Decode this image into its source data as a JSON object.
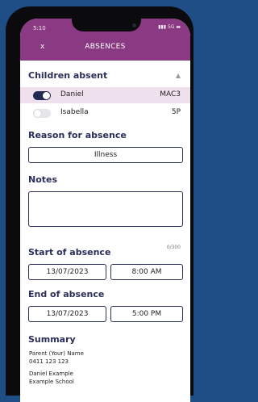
{
  "status": {
    "time": "5:10",
    "network": "5G"
  },
  "header": {
    "close_label": "x",
    "title": "ABSENCES"
  },
  "children_absent": {
    "heading": "Children absent",
    "children": [
      {
        "name": "Daniel",
        "class": "MAC3",
        "selected": true
      },
      {
        "name": "Isabella",
        "class": "5P",
        "selected": false
      }
    ]
  },
  "reason": {
    "heading": "Reason for absence",
    "value": "Illness"
  },
  "notes": {
    "heading": "Notes",
    "value": "",
    "counter": "0/300"
  },
  "start": {
    "heading": "Start of absence",
    "date": "13/07/2023",
    "time": "8:00 AM"
  },
  "end": {
    "heading": "End of absence",
    "date": "13/07/2023",
    "time": "5:00 PM"
  },
  "summary": {
    "heading": "Summary",
    "lines": [
      "Parent (Your) Name",
      "0411 123 123",
      "Daniel Example",
      "Example School"
    ]
  },
  "colors": {
    "header": "#8a3a82",
    "accent": "#2a2e5a",
    "selected_row": "#efe0ee"
  }
}
